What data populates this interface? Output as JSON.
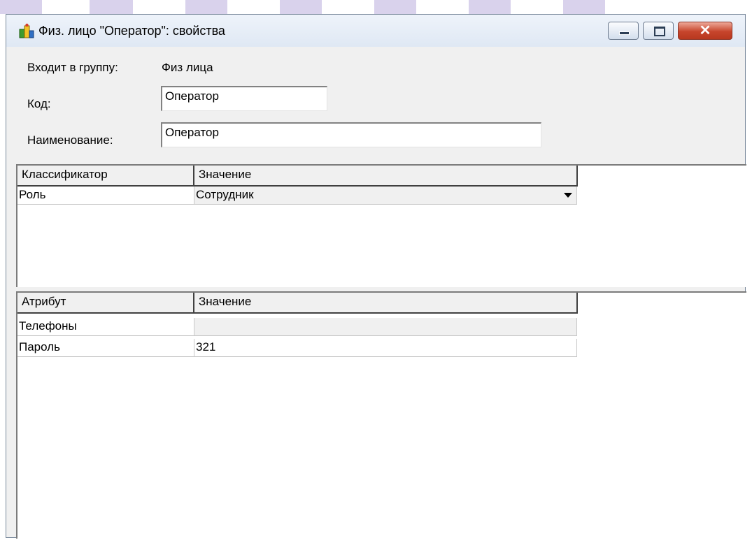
{
  "window": {
    "title": "Физ. лицо \"Оператор\": свойства",
    "icons": {
      "app": "people-icon",
      "minimize": "minimize-icon",
      "maximize": "maximize-icon",
      "close": "close-icon"
    },
    "close_symbol": "✕"
  },
  "form": {
    "group_label": "Входит в группу:",
    "group_value": "Физ лица",
    "code_label": "Код:",
    "code_value": "Оператор",
    "name_label": "Наименование:",
    "name_value": "Оператор"
  },
  "classifiers": {
    "columns": [
      "Классификатор",
      "Значение"
    ],
    "rows": [
      {
        "name": "Роль",
        "value": "Сотрудник"
      }
    ]
  },
  "attributes": {
    "columns": [
      "Атрибут",
      "Значение"
    ],
    "rows": [
      {
        "name": "Телефоны",
        "value": ""
      },
      {
        "name": "Пароль",
        "value": "321"
      }
    ]
  },
  "colors": {
    "close_button": "#c7452c",
    "titlebar": "#dfe8f4",
    "window_bg": "#f0f0f0"
  }
}
